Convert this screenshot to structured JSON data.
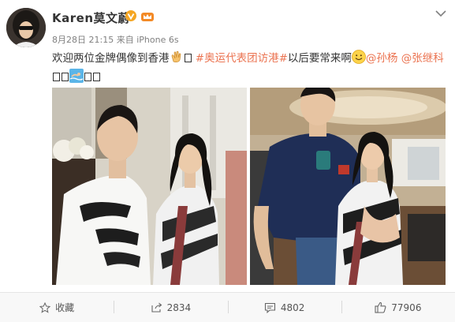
{
  "user": {
    "name": "Karen莫文蔚"
  },
  "meta": {
    "timestamp": "8月28日 21:15",
    "from_prefix": "来自",
    "device": "iPhone 6s"
  },
  "post": {
    "text_1": "欢迎两位金牌偶像到香港",
    "hashtag": "#奥运代表团访港#",
    "text_2": "以后要常来啊",
    "mention_1": "@孙杨",
    "mention_2": "@张继科"
  },
  "actions": {
    "favorite": "收藏",
    "repost_count": "2834",
    "comment_count": "4802",
    "like_count": "77906"
  },
  "icons": {
    "verified": "verified-v-icon",
    "member": "member-crown-icon",
    "menu": "chevron-down-icon",
    "emoji_clap": "clapping-hands-icon",
    "emoji_smile": "smile-icon",
    "emoji_swim": "swimmer-icon",
    "favorite": "star-icon",
    "repost": "share-arrow-icon",
    "comment": "comment-bubble-icon",
    "like": "thumbs-up-icon"
  },
  "colors": {
    "link": "#eb7350",
    "verified": "#f5a623",
    "text": "#333333",
    "muted": "#808080"
  }
}
